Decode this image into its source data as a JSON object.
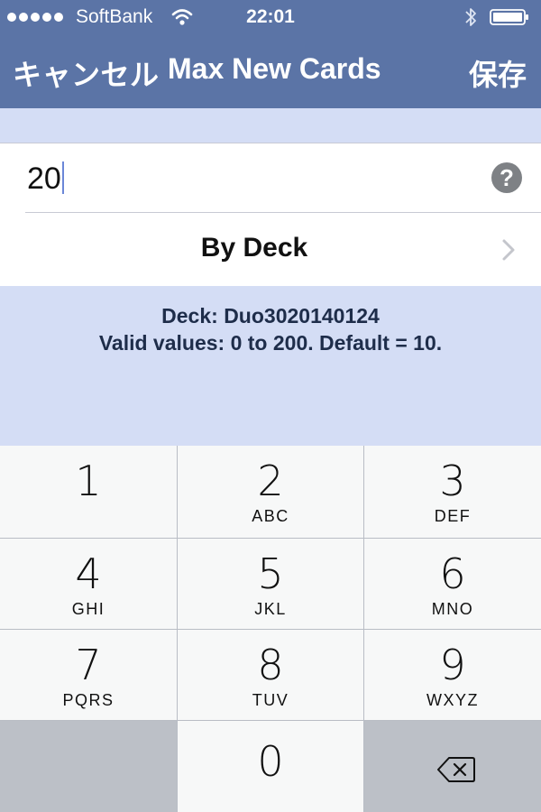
{
  "status_bar": {
    "carrier": "SoftBank",
    "time": "22:01"
  },
  "nav": {
    "cancel_label": "キャンセル",
    "title": "Max New Cards",
    "save_label": "保存"
  },
  "setting": {
    "value": "20",
    "scope_label": "By Deck"
  },
  "info": {
    "deck_line": "Deck: Duo3020140124",
    "valid_line": "Valid values: 0 to 200.  Default = 10."
  },
  "keypad": {
    "keys": [
      {
        "digit": "1",
        "letters": ""
      },
      {
        "digit": "2",
        "letters": "ABC"
      },
      {
        "digit": "3",
        "letters": "DEF"
      },
      {
        "digit": "4",
        "letters": "GHI"
      },
      {
        "digit": "5",
        "letters": "JKL"
      },
      {
        "digit": "6",
        "letters": "MNO"
      },
      {
        "digit": "7",
        "letters": "PQRS"
      },
      {
        "digit": "8",
        "letters": "TUV"
      },
      {
        "digit": "9",
        "letters": "WXYZ"
      },
      {
        "digit": "0",
        "letters": ""
      }
    ]
  },
  "colors": {
    "nav_background": "#5b74a6",
    "content_background": "#d4ddf5",
    "info_text": "#1e2d4a",
    "caret": "#6b87d8"
  },
  "icons": {
    "help": "question-circle-icon",
    "disclosure": "chevron-right-icon",
    "delete": "backspace-icon",
    "wifi": "wifi-icon",
    "bluetooth": "bluetooth-icon",
    "battery": "battery-icon"
  }
}
